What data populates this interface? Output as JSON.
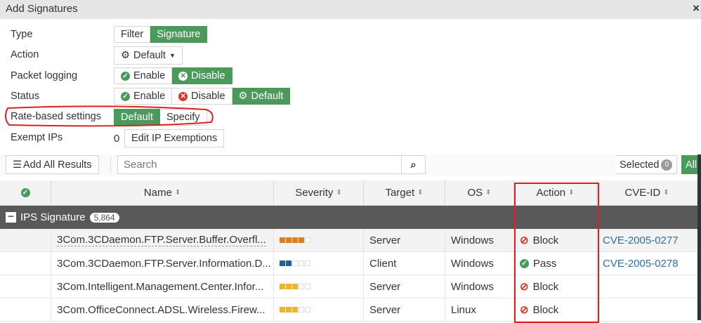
{
  "title": "Add Signatures",
  "form": {
    "type": {
      "label": "Type",
      "options": [
        "Filter",
        "Signature"
      ],
      "selected": "Signature"
    },
    "action": {
      "label": "Action",
      "value": "Default"
    },
    "packet_logging": {
      "label": "Packet logging",
      "options": [
        "Enable",
        "Disable"
      ],
      "selected": "Disable"
    },
    "status": {
      "label": "Status",
      "options": [
        "Enable",
        "Disable",
        "Default"
      ],
      "selected": "Default"
    },
    "rate_based": {
      "label": "Rate-based settings",
      "options": [
        "Default",
        "Specify"
      ],
      "selected": "Default"
    },
    "exempt_ips": {
      "label": "Exempt IPs",
      "count": "0",
      "button": "Edit IP Exemptions"
    }
  },
  "toolbar": {
    "add_all": "Add All Results",
    "search_placeholder": "Search",
    "selected_label": "Selected",
    "selected_count": "0",
    "all_label": "All"
  },
  "table": {
    "headers": [
      "Name",
      "Severity",
      "Target",
      "OS",
      "Action",
      "CVE-ID"
    ],
    "group": {
      "label": "IPS Signature",
      "count": "5,864"
    },
    "rows": [
      {
        "name": "3Com.3CDaemon.FTP.Server.Buffer.Overfl...",
        "severity": 4,
        "sev_color": "#e07b1f",
        "target": "Server",
        "os": "Windows",
        "action": "Block",
        "cve": "CVE-2005-0277"
      },
      {
        "name": "3Com.3CDaemon.FTP.Server.Information.D...",
        "severity": 2,
        "sev_color": "#1f5f9a",
        "target": "Client",
        "os": "Windows",
        "action": "Pass",
        "cve": "CVE-2005-0278"
      },
      {
        "name": "3Com.Intelligent.Management.Center.Infor...",
        "severity": 3,
        "sev_color": "#f0b429",
        "target": "Server",
        "os": "Windows",
        "action": "Block",
        "cve": ""
      },
      {
        "name": "3Com.OfficeConnect.ADSL.Wireless.Firew...",
        "severity": 3,
        "sev_color": "#f0b429",
        "target": "Server",
        "os": "Linux",
        "action": "Block",
        "cve": ""
      }
    ]
  }
}
